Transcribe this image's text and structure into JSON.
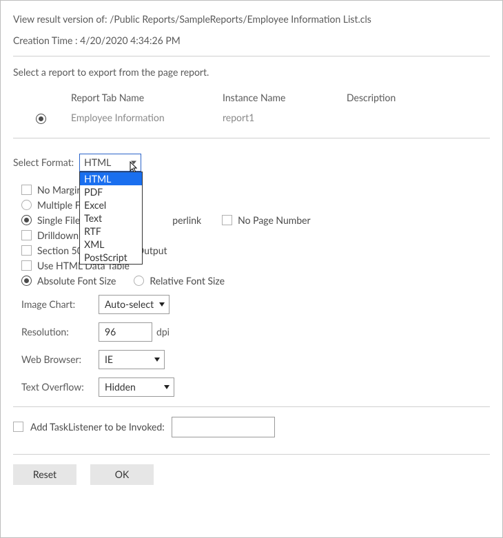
{
  "header": {
    "title": "View result version of: /Public Reports/SampleReports/Employee Information List.cls",
    "creation_time_label": "Creation Time :",
    "creation_time_value": "4/20/2020 4:34:26 PM"
  },
  "report_section": {
    "prompt": "Select a report to export from the page report.",
    "columns": {
      "report_tab": "Report Tab Name",
      "instance": "Instance Name",
      "description": "Description"
    },
    "rows": [
      {
        "selected": true,
        "report_tab": "Employee Information",
        "instance": "report1",
        "description": ""
      }
    ]
  },
  "format": {
    "label": "Select Format:",
    "selected": "HTML",
    "options": [
      "HTML",
      "PDF",
      "Excel",
      "Text",
      "RTF",
      "XML",
      "PostScript"
    ]
  },
  "options": {
    "no_margin": "No Margin",
    "multiple_files": "Multiple Files",
    "single_file": "Single File",
    "hyperlink_partial": "perlink",
    "no_page_number": "No Page Number",
    "drilldown": "Drilldown",
    "section508": "Section 508 Compliant Output",
    "use_html_table": "Use HTML Data Table",
    "abs_font": "Absolute Font Size",
    "rel_font": "Relative Font Size"
  },
  "settings": {
    "image_chart": {
      "label": "Image Chart:",
      "value": "Auto-select"
    },
    "resolution": {
      "label": "Resolution:",
      "value": "96",
      "unit": "dpi"
    },
    "web_browser": {
      "label": "Web Browser:",
      "value": "IE"
    },
    "text_overflow": {
      "label": "Text Overflow:",
      "value": "Hidden"
    }
  },
  "tasklistener": {
    "label": "Add TaskListener to be Invoked:",
    "value": ""
  },
  "buttons": {
    "reset": "Reset",
    "ok": "OK"
  }
}
